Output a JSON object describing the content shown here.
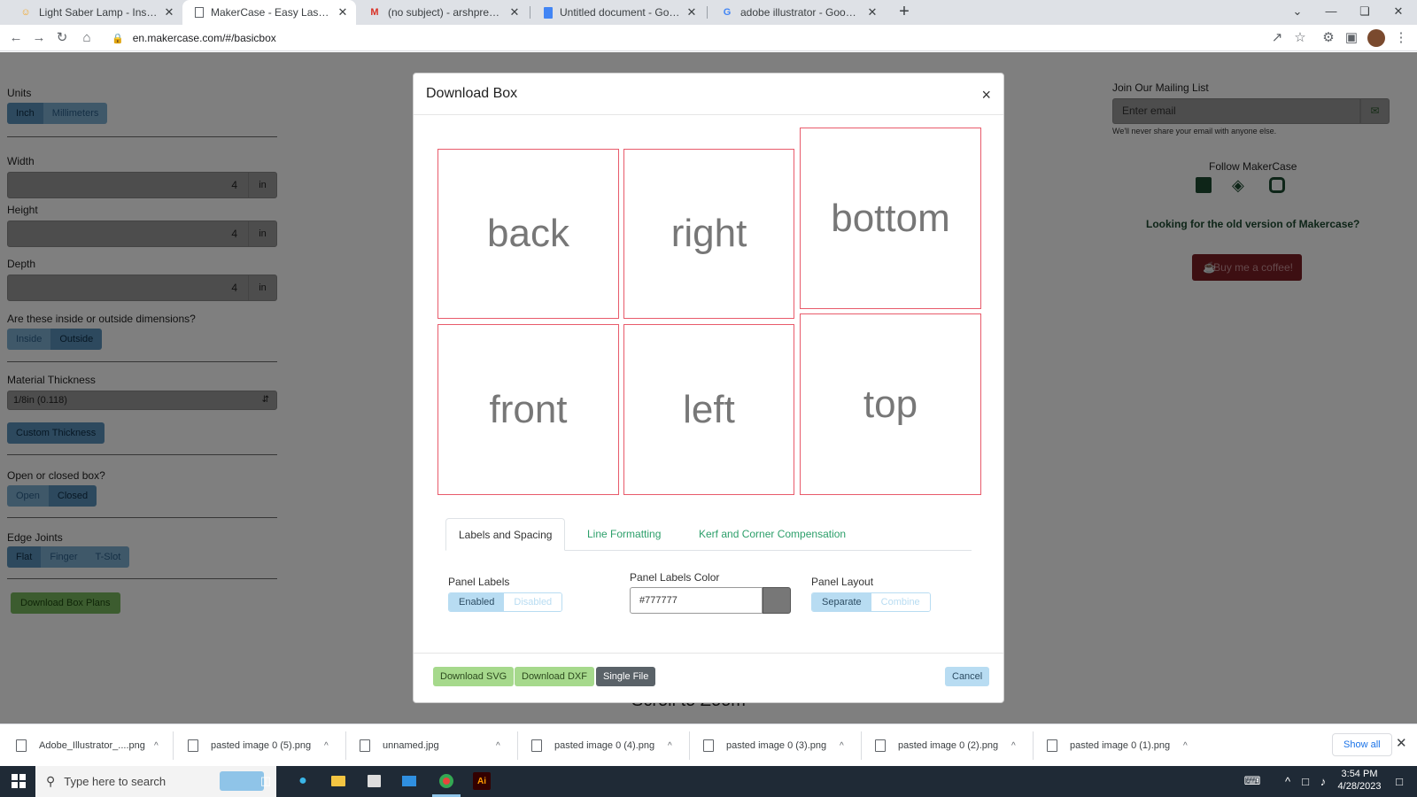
{
  "browser": {
    "tabs": [
      {
        "title": "Light Saber Lamp - Instructables",
        "icon": "instructables-icon"
      },
      {
        "title": "MakerCase - Easy Laser Cut Case",
        "icon": "document-icon"
      },
      {
        "title": "(no subject) - arshpreetsingh200",
        "icon": "gmail-icon"
      },
      {
        "title": "Untitled document - Google Doc",
        "icon": "google-docs-icon"
      },
      {
        "title": "adobe illustrator - Google Search",
        "icon": "google-icon"
      }
    ],
    "url": "en.makercase.com/#/basicbox"
  },
  "left_panel": {
    "units_label": "Units",
    "units": [
      "Inch",
      "Millimeters"
    ],
    "width_label": "Width",
    "width_value": "4",
    "width_unit": "in",
    "height_label": "Height",
    "height_value": "4",
    "height_unit": "in",
    "depth_label": "Depth",
    "depth_value": "4",
    "depth_unit": "in",
    "dims_label": "Are these inside or outside dimensions?",
    "dims": [
      "Inside",
      "Outside"
    ],
    "material_label": "Material Thickness",
    "material_value": "1/8in (0.118)",
    "custom_thickness": "Custom Thickness",
    "open_label": "Open or closed box?",
    "open_options": [
      "Open",
      "Closed"
    ],
    "edge_label": "Edge Joints",
    "edge_options": [
      "Flat",
      "Finger",
      "T-Slot"
    ],
    "download_plans": "Download Box Plans"
  },
  "right_panel": {
    "mailing_label": "Join Our Mailing List",
    "email_placeholder": "Enter email",
    "privacy": "We'll never share your email with anyone else.",
    "follow": "Follow MakerCase",
    "old_version": "Looking for the old version of Makercase?",
    "coffee": "Buy me a coffee!"
  },
  "background_text": "Scroll to Zoom",
  "modal": {
    "title": "Download Box",
    "close": "×",
    "panels": {
      "back": "back",
      "right": "right",
      "bottom": "bottom",
      "front": "front",
      "left": "left",
      "top": "top"
    },
    "tabs": [
      "Labels and Spacing",
      "Line Formatting",
      "Kerf and Corner Compensation"
    ],
    "panel_labels_label": "Panel Labels",
    "panel_labels_options": [
      "Enabled",
      "Disabled"
    ],
    "panel_labels_color_label": "Panel Labels Color",
    "panel_labels_color_value": "#777777",
    "panel_layout_label": "Panel Layout",
    "panel_layout_options": [
      "Separate",
      "Combine"
    ],
    "download_svg": "Download SVG",
    "download_dxf": "Download DXF",
    "single_file": "Single File",
    "cancel": "Cancel"
  },
  "downloads": [
    "Adobe_Illustrator_....png",
    "pasted image 0 (5).png",
    "unnamed.jpg",
    "pasted image 0 (4).png",
    "pasted image 0 (3).png",
    "pasted image 0 (2).png",
    "pasted image 0 (1).png"
  ],
  "show_all": "Show all",
  "taskbar": {
    "search_placeholder": "Type here to search",
    "time": "3:54 PM",
    "date": "4/28/2023"
  },
  "colors": {
    "panel_border": "#e85b6b",
    "label_color": "#777777",
    "accent_green": "#2c9f6a"
  }
}
